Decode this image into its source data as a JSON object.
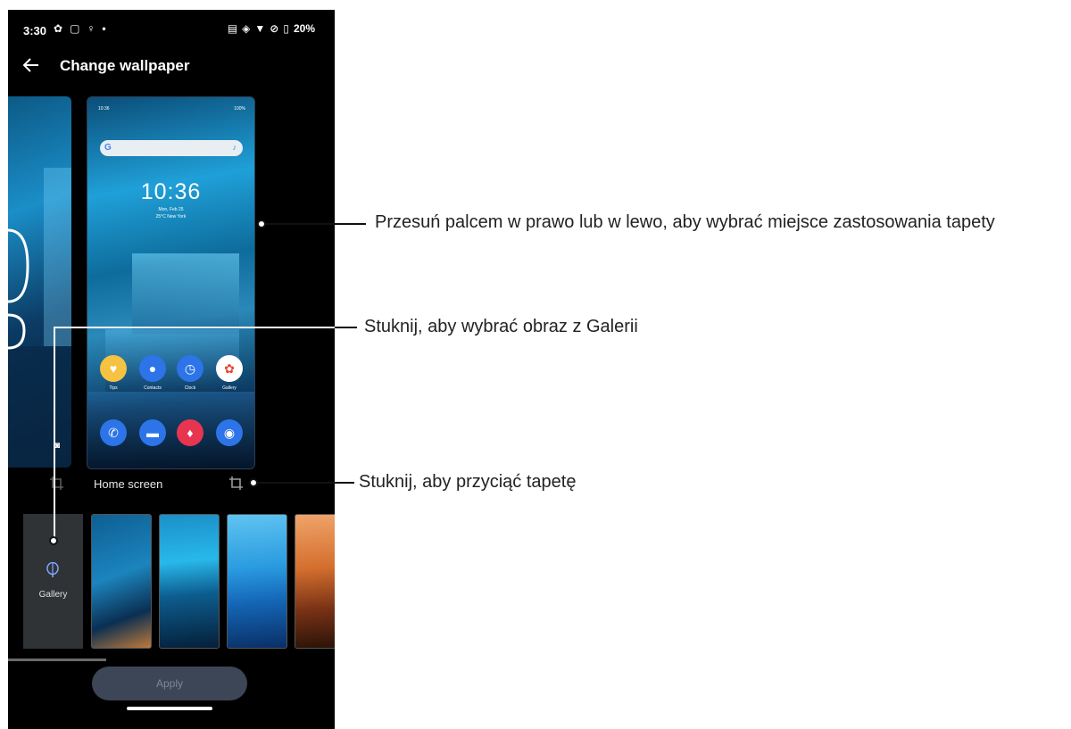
{
  "status_bar": {
    "time": "3:30",
    "battery": "20%"
  },
  "header": {
    "title": "Change wallpaper"
  },
  "preview": {
    "time": "10:36",
    "clock": "10:36",
    "date": "Mon, Feb 25",
    "weather": "25°C New York",
    "battery": "100%",
    "apps_row1": [
      "Tips",
      "Contacts",
      "Clock",
      "Gallery"
    ]
  },
  "captions": {
    "home_screen": "Home screen"
  },
  "gallery_tile": {
    "label": "Gallery"
  },
  "buttons": {
    "apply": "Apply"
  },
  "callouts": {
    "swipe": "Przesuń palcem w prawo lub w lewo, aby wybrać miejsce zastosowania tapety",
    "gallery": "Stuknij, aby wybrać obraz z Galerii",
    "crop": "Stuknij, aby przyciąć tapetę"
  },
  "colors": {
    "phone_bg": "#000000",
    "apply_button": "#3c4656",
    "gallery_tile": "#2f3336"
  }
}
